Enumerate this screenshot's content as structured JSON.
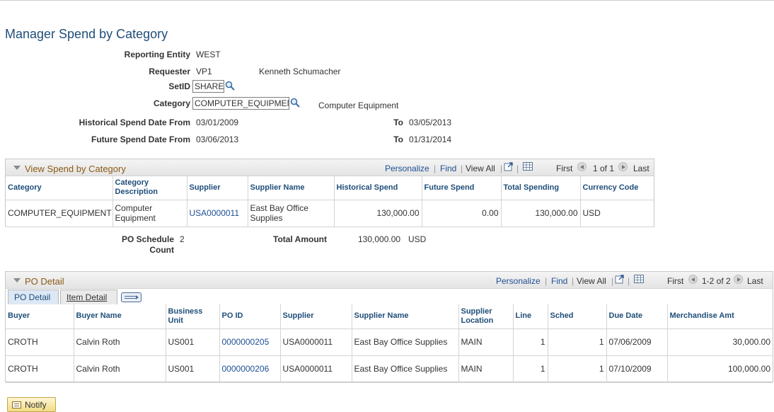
{
  "page_title": "Manager Spend by Category",
  "form": {
    "reporting_entity_label": "Reporting Entity",
    "reporting_entity_value": "WEST",
    "requester_label": "Requester",
    "requester_id": "VP1",
    "requester_name": "Kenneth Schumacher",
    "setid_label": "SetID",
    "setid_value": "SHARE",
    "category_label": "Category",
    "category_value": "COMPUTER_EQUIPMENT",
    "category_description": "Computer Equipment",
    "hist_from_label": "Historical Spend Date From",
    "hist_from_value": "03/01/2009",
    "hist_to_label": "To",
    "hist_to_value": "03/05/2013",
    "future_from_label": "Future Spend Date From",
    "future_from_value": "03/06/2013",
    "future_to_label": "To",
    "future_to_value": "01/31/2014"
  },
  "spend_grid": {
    "title": "View Spend by Category",
    "personalize": "Personalize",
    "find": "Find",
    "view_all": "View All",
    "first": "First",
    "range": "1 of 1",
    "last": "Last",
    "columns": [
      "Category",
      "Category Description",
      "Supplier",
      "Supplier Name",
      "Historical Spend",
      "Future Spend",
      "Total Spending",
      "Currency Code"
    ],
    "rows": [
      {
        "category": "COMPUTER_EQUIPMENT",
        "category_desc": "Computer Equipment",
        "supplier": "USA0000011",
        "supplier_name": "East Bay Office Supplies",
        "historical": "130,000.00",
        "future": "0.00",
        "total": "130,000.00",
        "currency": "USD"
      }
    ]
  },
  "summary": {
    "po_schedule_count_label": "PO Schedule Count",
    "po_schedule_count_value": "2",
    "total_amount_label": "Total Amount",
    "total_amount_value": "130,000.00",
    "total_amount_currency": "USD"
  },
  "po_grid": {
    "title": "PO Detail",
    "personalize": "Personalize",
    "find": "Find",
    "view_all": "View All",
    "first": "First",
    "range": "1-2 of 2",
    "last": "Last",
    "tabs": [
      "PO Detail",
      "Item Detail"
    ],
    "columns": [
      "Buyer",
      "Buyer Name",
      "Business Unit",
      "PO ID",
      "Supplier",
      "Supplier Name",
      "Supplier Location",
      "Line",
      "Sched",
      "Due Date",
      "Merchandise Amt"
    ],
    "rows": [
      {
        "buyer": "CROTH",
        "buyer_name": "Calvin Roth",
        "bu": "US001",
        "po_id": "0000000205",
        "supplier": "USA0000011",
        "supplier_name": "East Bay Office Supplies",
        "location": "MAIN",
        "line": "1",
        "sched": "1",
        "due_date": "07/06/2009",
        "amount": "30,000.00"
      },
      {
        "buyer": "CROTH",
        "buyer_name": "Calvin Roth",
        "bu": "US001",
        "po_id": "0000000206",
        "supplier": "USA0000011",
        "supplier_name": "East Bay Office Supplies",
        "location": "MAIN",
        "line": "1",
        "sched": "1",
        "due_date": "07/10/2009",
        "amount": "100,000.00"
      }
    ]
  },
  "notify_label": "Notify",
  "icons": {
    "lookup": "magnifier-icon",
    "zoom": "zoom-icon",
    "download": "spreadsheet-icon",
    "show_all_columns": "show-all-columns-icon",
    "notify": "notify-icon"
  }
}
